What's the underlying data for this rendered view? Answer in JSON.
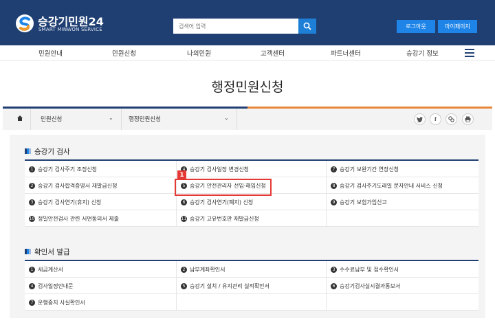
{
  "header": {
    "logo_title": "승강기민원24",
    "logo_subtitle": "SMART MINWON SERVICE",
    "search_placeholder": "검색어 입력",
    "logout_label": "로그아웃",
    "mypage_label": "마이페이지"
  },
  "nav": {
    "items": [
      "민원안내",
      "민원신청",
      "나의민원",
      "고객센터",
      "파트너센터",
      "승강기 정보"
    ]
  },
  "page_title": "행정민원신청",
  "breadcrumb": {
    "level1": "민원신청",
    "level2": "행정민원신청"
  },
  "share_icons": [
    "twitter-icon",
    "facebook-icon",
    "link-icon",
    "print-icon"
  ],
  "sections": [
    {
      "title": "승강기 검사",
      "rows": [
        [
          {
            "num": "1",
            "label": "승강기 검사주기 조정신청"
          },
          {
            "num": "4",
            "label": "승강기 검사일정 변경신청"
          },
          {
            "num": "7",
            "label": "승강기 보완기간 연장신청"
          }
        ],
        [
          {
            "num": "2",
            "label": "승강기 검사합격증명서 재발급신청"
          },
          {
            "num": "5",
            "label": "승강기 안전관리자 선임·해임신청"
          },
          {
            "num": "8",
            "label": "승강기 검사주기도래일 문자안내 서비스 신청"
          }
        ],
        [
          {
            "num": "3",
            "label": "승강기 검사연기(휴지) 신청"
          },
          {
            "num": "6",
            "label": "승강기 검사연기(폐지) 신청"
          },
          {
            "num": "9",
            "label": "승강기 보험가입신고"
          }
        ],
        [
          {
            "num": "10",
            "label": "정밀안전검사 관련 서면동의서 제출"
          },
          {
            "num": "11",
            "label": "승강기 고유번호판 재발급신청"
          },
          {
            "num": "",
            "label": ""
          }
        ]
      ]
    },
    {
      "title": "확인서 발급",
      "rows": [
        [
          {
            "num": "1",
            "label": "세금계산서"
          },
          {
            "num": "2",
            "label": "납부계좌확인서"
          },
          {
            "num": "3",
            "label": "수수료납부 및 접수확인서"
          }
        ],
        [
          {
            "num": "4",
            "label": "검사일정안내문"
          },
          {
            "num": "5",
            "label": "승강기 설치 / 유지관리 실적확인서"
          },
          {
            "num": "6",
            "label": "승강기검사실시결과통보서"
          }
        ],
        [
          {
            "num": "7",
            "label": "운행중지 사실확인서"
          },
          {
            "num": "",
            "label": ""
          },
          {
            "num": "",
            "label": ""
          }
        ]
      ]
    }
  ],
  "annotation_badge": "1",
  "colors": {
    "header_bg": "#1f3f72",
    "accent_blue": "#1e84e8",
    "accent_orange": "#e8873a",
    "highlight_red": "#e53935"
  }
}
